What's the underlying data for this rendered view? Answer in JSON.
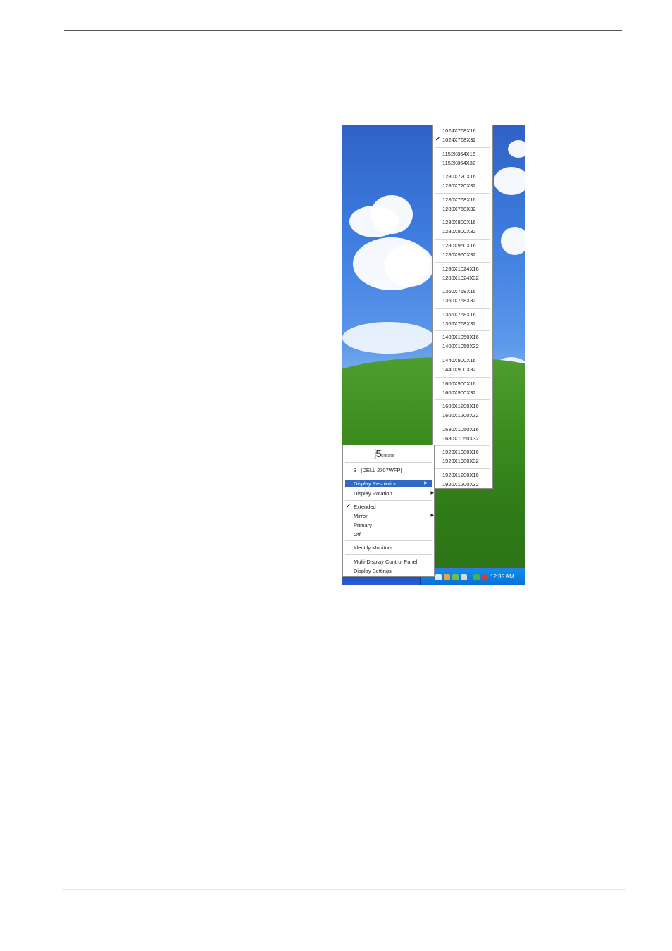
{
  "resolution_menu": {
    "items": [
      [
        "1024X768X16",
        "1024X768X32"
      ],
      [
        "1152X864X16",
        "1152X864X32"
      ],
      [
        "1280X720X16",
        "1280X720X32"
      ],
      [
        "1280X768X16",
        "1280X768X32"
      ],
      [
        "1280X800X16",
        "1280X800X32"
      ],
      [
        "1280X960X16",
        "1280X960X32"
      ],
      [
        "1280X1024X16",
        "1280X1024X32"
      ],
      [
        "1360X768X16",
        "1360X768X32"
      ],
      [
        "1366X768X16",
        "1366X768X32"
      ],
      [
        "1400X1050X16",
        "1400X1050X32"
      ],
      [
        "1440X900X16",
        "1440X900X32"
      ],
      [
        "1600X900X16",
        "1600X900X32"
      ],
      [
        "1600X1200X16",
        "1600X1200X32"
      ],
      [
        "1680X1050X16",
        "1680X1050X32"
      ],
      [
        "1920X1080X16",
        "1920X1080X32"
      ],
      [
        "1920X1200X16",
        "1920X1200X32"
      ]
    ],
    "selected": "1024X768X32",
    "check_glyph": "✔"
  },
  "context_menu": {
    "logo": "j5",
    "logo_sub": "create",
    "monitor_label": "3 : [DELL 2707WFP]",
    "display_resolution": "Display Resolution",
    "display_rotation": "Display Rotation",
    "extended": "Extended",
    "mirror": "Mirror",
    "primary": "Primary",
    "off": "Off",
    "identify_monitors": "Identify Monitors",
    "control_panel": "Multi-Display Control Panel",
    "display_settings": "Display Settings",
    "submenu_arrow": "▶",
    "check_glyph": "✔"
  },
  "taskbar": {
    "clock": "12:35 AM"
  },
  "colors": {
    "menu_highlight": "#316ac5",
    "taskbar": "#2451c4",
    "tray": "#0f8dea"
  }
}
